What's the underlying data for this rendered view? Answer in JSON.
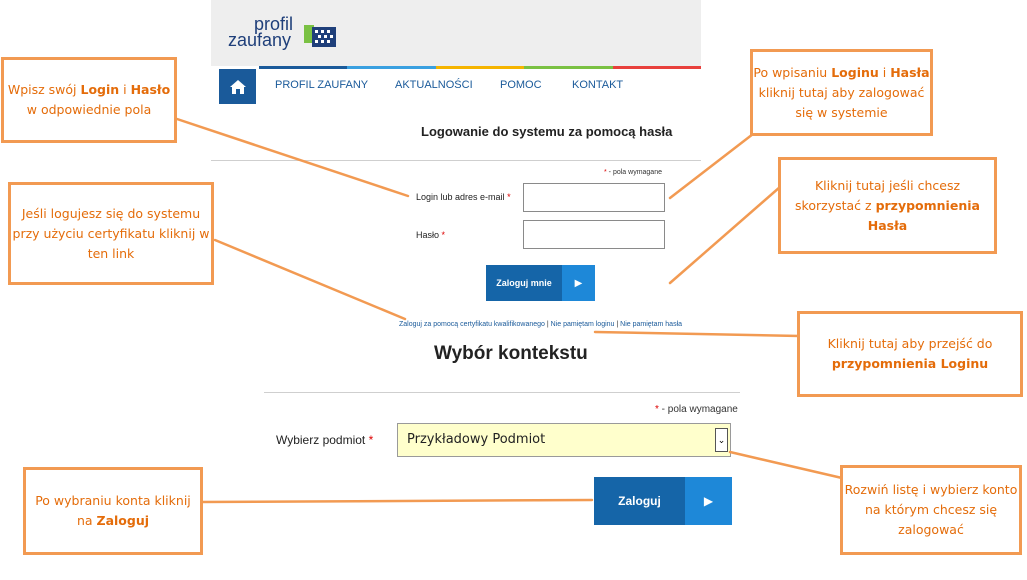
{
  "logo": {
    "line1": "profil",
    "line2": "zaufany"
  },
  "nav": {
    "items": [
      "PROFIL ZAUFANY",
      "AKTUALNOŚCI",
      "POMOC",
      "KONTAKT"
    ],
    "stripe_colors": [
      "#1a5a9a",
      "#3aa0e0",
      "#f5b400",
      "#7ac143",
      "#e8403c"
    ]
  },
  "login": {
    "title": "Logowanie do systemu za pomocą hasła",
    "required_star": "*",
    "required_note": " - pola wymagane",
    "login_label": "Login lub adres e-mail",
    "password_label": "Hasło",
    "login_button": "Zaloguj mnie",
    "links": {
      "cert": "Zaloguj za pomocą certyfikatu kwalifikowanego",
      "sep": " | ",
      "forgot_login": "Nie pamiętam loginu",
      "forgot_password": "Nie pamiętam hasła"
    }
  },
  "context": {
    "title": "Wybór kontekstu",
    "required_star": "*",
    "required_note": " - pola wymagane",
    "select_label": "Wybierz podmiot",
    "select_value": "Przykładowy Podmiot",
    "button": "Zaloguj"
  },
  "callouts": {
    "c1": {
      "a": "Wpisz swój ",
      "b": "Login",
      "c": " i ",
      "d": "Hasło",
      "e": " w odpowiednie pola"
    },
    "c2": {
      "a": "Jeśli logujesz się do systemu  przy użyciu certyfikatu kliknij w ten link"
    },
    "c3": {
      "a": "Po wpisaniu ",
      "b": "Loginu",
      "c": " i ",
      "d": "Hasła",
      "e": " kliknij tutaj aby zalogować się w systemie"
    },
    "c4": {
      "a": "Kliknij tutaj jeśli chcesz skorzystać z ",
      "b": "przypomnienia Hasła"
    },
    "c5": {
      "a": "Kliknij tutaj aby przejść do ",
      "b": "przypomnienia Loginu"
    },
    "c6": {
      "a": "Po wybraniu konta kliknij na ",
      "b": "Zaloguj"
    },
    "c7": {
      "a": "Rozwiń listę i wybierz konto na którym chcesz się zalogować"
    }
  },
  "colors": {
    "accent": "#e46c0a",
    "callout_border": "#f29a52",
    "primary": "#1565a8"
  }
}
